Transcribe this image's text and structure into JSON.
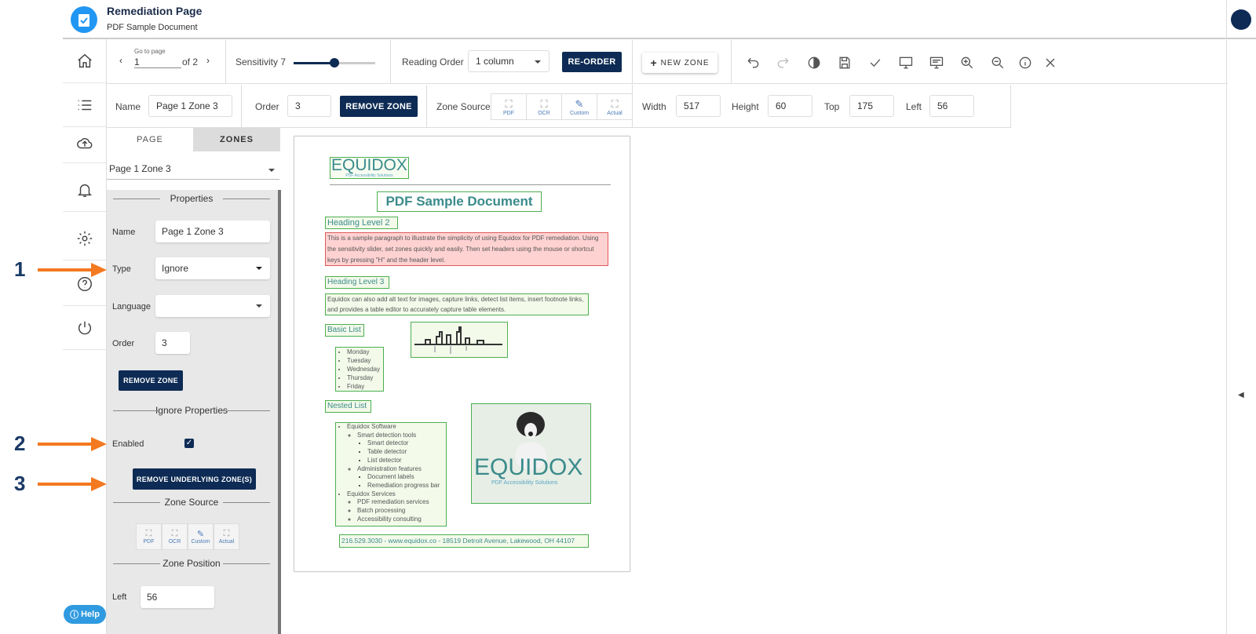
{
  "header": {
    "title": "Remediation Page",
    "subtitle": "PDF Sample Document"
  },
  "toolbar": {
    "go_to_page_label": "Go to page",
    "page_value": "1",
    "page_of": "of 2",
    "sensitivity_label": "Sensitivity 7",
    "sensitivity_level": 0.5,
    "reading_order_label": "Reading Order",
    "reading_order_value": "1 column",
    "reorder_label": "RE-ORDER",
    "new_zone_label": "NEW ZONE",
    "icons": [
      "undo-icon",
      "redo-icon",
      "contrast-icon",
      "save-icon",
      "check-icon",
      "monitor-icon",
      "preview-icon",
      "zoom-in-icon",
      "zoom-out-icon",
      "info-icon",
      "close-icon"
    ]
  },
  "zonebar": {
    "name_label": "Name",
    "name_value": "Page 1 Zone 3",
    "order_label": "Order",
    "order_value": "3",
    "remove_zone_label": "REMOVE ZONE",
    "zone_source_label": "Zone Source",
    "sources": [
      {
        "tag": "PDF",
        "label": "PDF"
      },
      {
        "tag": "OCR",
        "label": "OCR"
      },
      {
        "tag": "",
        "label": "Custom"
      },
      {
        "tag": "ACT",
        "label": "Actual"
      }
    ],
    "width_label": "Width",
    "width_value": "517",
    "height_label": "Height",
    "height_value": "60",
    "top_label": "Top",
    "top_value": "175",
    "left_label": "Left",
    "left_value": "56"
  },
  "panel": {
    "tab_page": "PAGE",
    "tab_zones": "ZONES",
    "zone_select": "Page 1 Zone 3",
    "properties_title": "Properties",
    "name_label": "Name",
    "name_value": "Page 1 Zone 3",
    "type_label": "Type",
    "type_value": "Ignore",
    "language_label": "Language",
    "language_value": "",
    "order_label": "Order",
    "order_value": "3",
    "remove_zone_label": "REMOVE ZONE",
    "ignore_title": "Ignore Properties",
    "enabled_label": "Enabled",
    "enabled": true,
    "remove_underlying_label": "REMOVE UNDERLYING ZONE(S)",
    "zone_source_title": "Zone Source",
    "zone_position_title": "Zone Position",
    "left_label": "Left",
    "left_value": "56"
  },
  "help_label": "Help",
  "annotations": [
    "1",
    "2",
    "3"
  ],
  "document": {
    "logo": "EQUIDOX",
    "logo_sub": "PDF Accessibility Solutions",
    "title": "PDF Sample Document",
    "h2": "Heading Level 2",
    "para1": "This is a sample paragraph to illustrate the simplicity of using Equidox for PDF remediation. Using the sensitivity slider, set zones quickly and easily.  Then set headers using the mouse or shortcut keys by pressing \"H\" and the header level.",
    "h3": "Heading Level 3",
    "para2": "Equidox can also add alt text for images, capture links, detect list items, insert footnote links, and provides a table editor to accurately capture table elements.",
    "basic_list_title": "Basic List",
    "basic_list": [
      "Monday",
      "Tuesday",
      "Wednesday",
      "Thursday",
      "Friday"
    ],
    "nested_list_title": "Nested List",
    "nested": [
      "Equidox Software",
      "Smart detection tools",
      "Smart detector",
      "Table detector",
      "List detector",
      "Administration features",
      "Document labels",
      "Remediation progress bar",
      "Equidox Services",
      "PDF remediation services",
      "Batch processing",
      "Accessibility consulting"
    ],
    "footer": "216.529.3030 - www.equidox.co - 18519 Detroit Avenue, Lakewood, OH 44107"
  }
}
